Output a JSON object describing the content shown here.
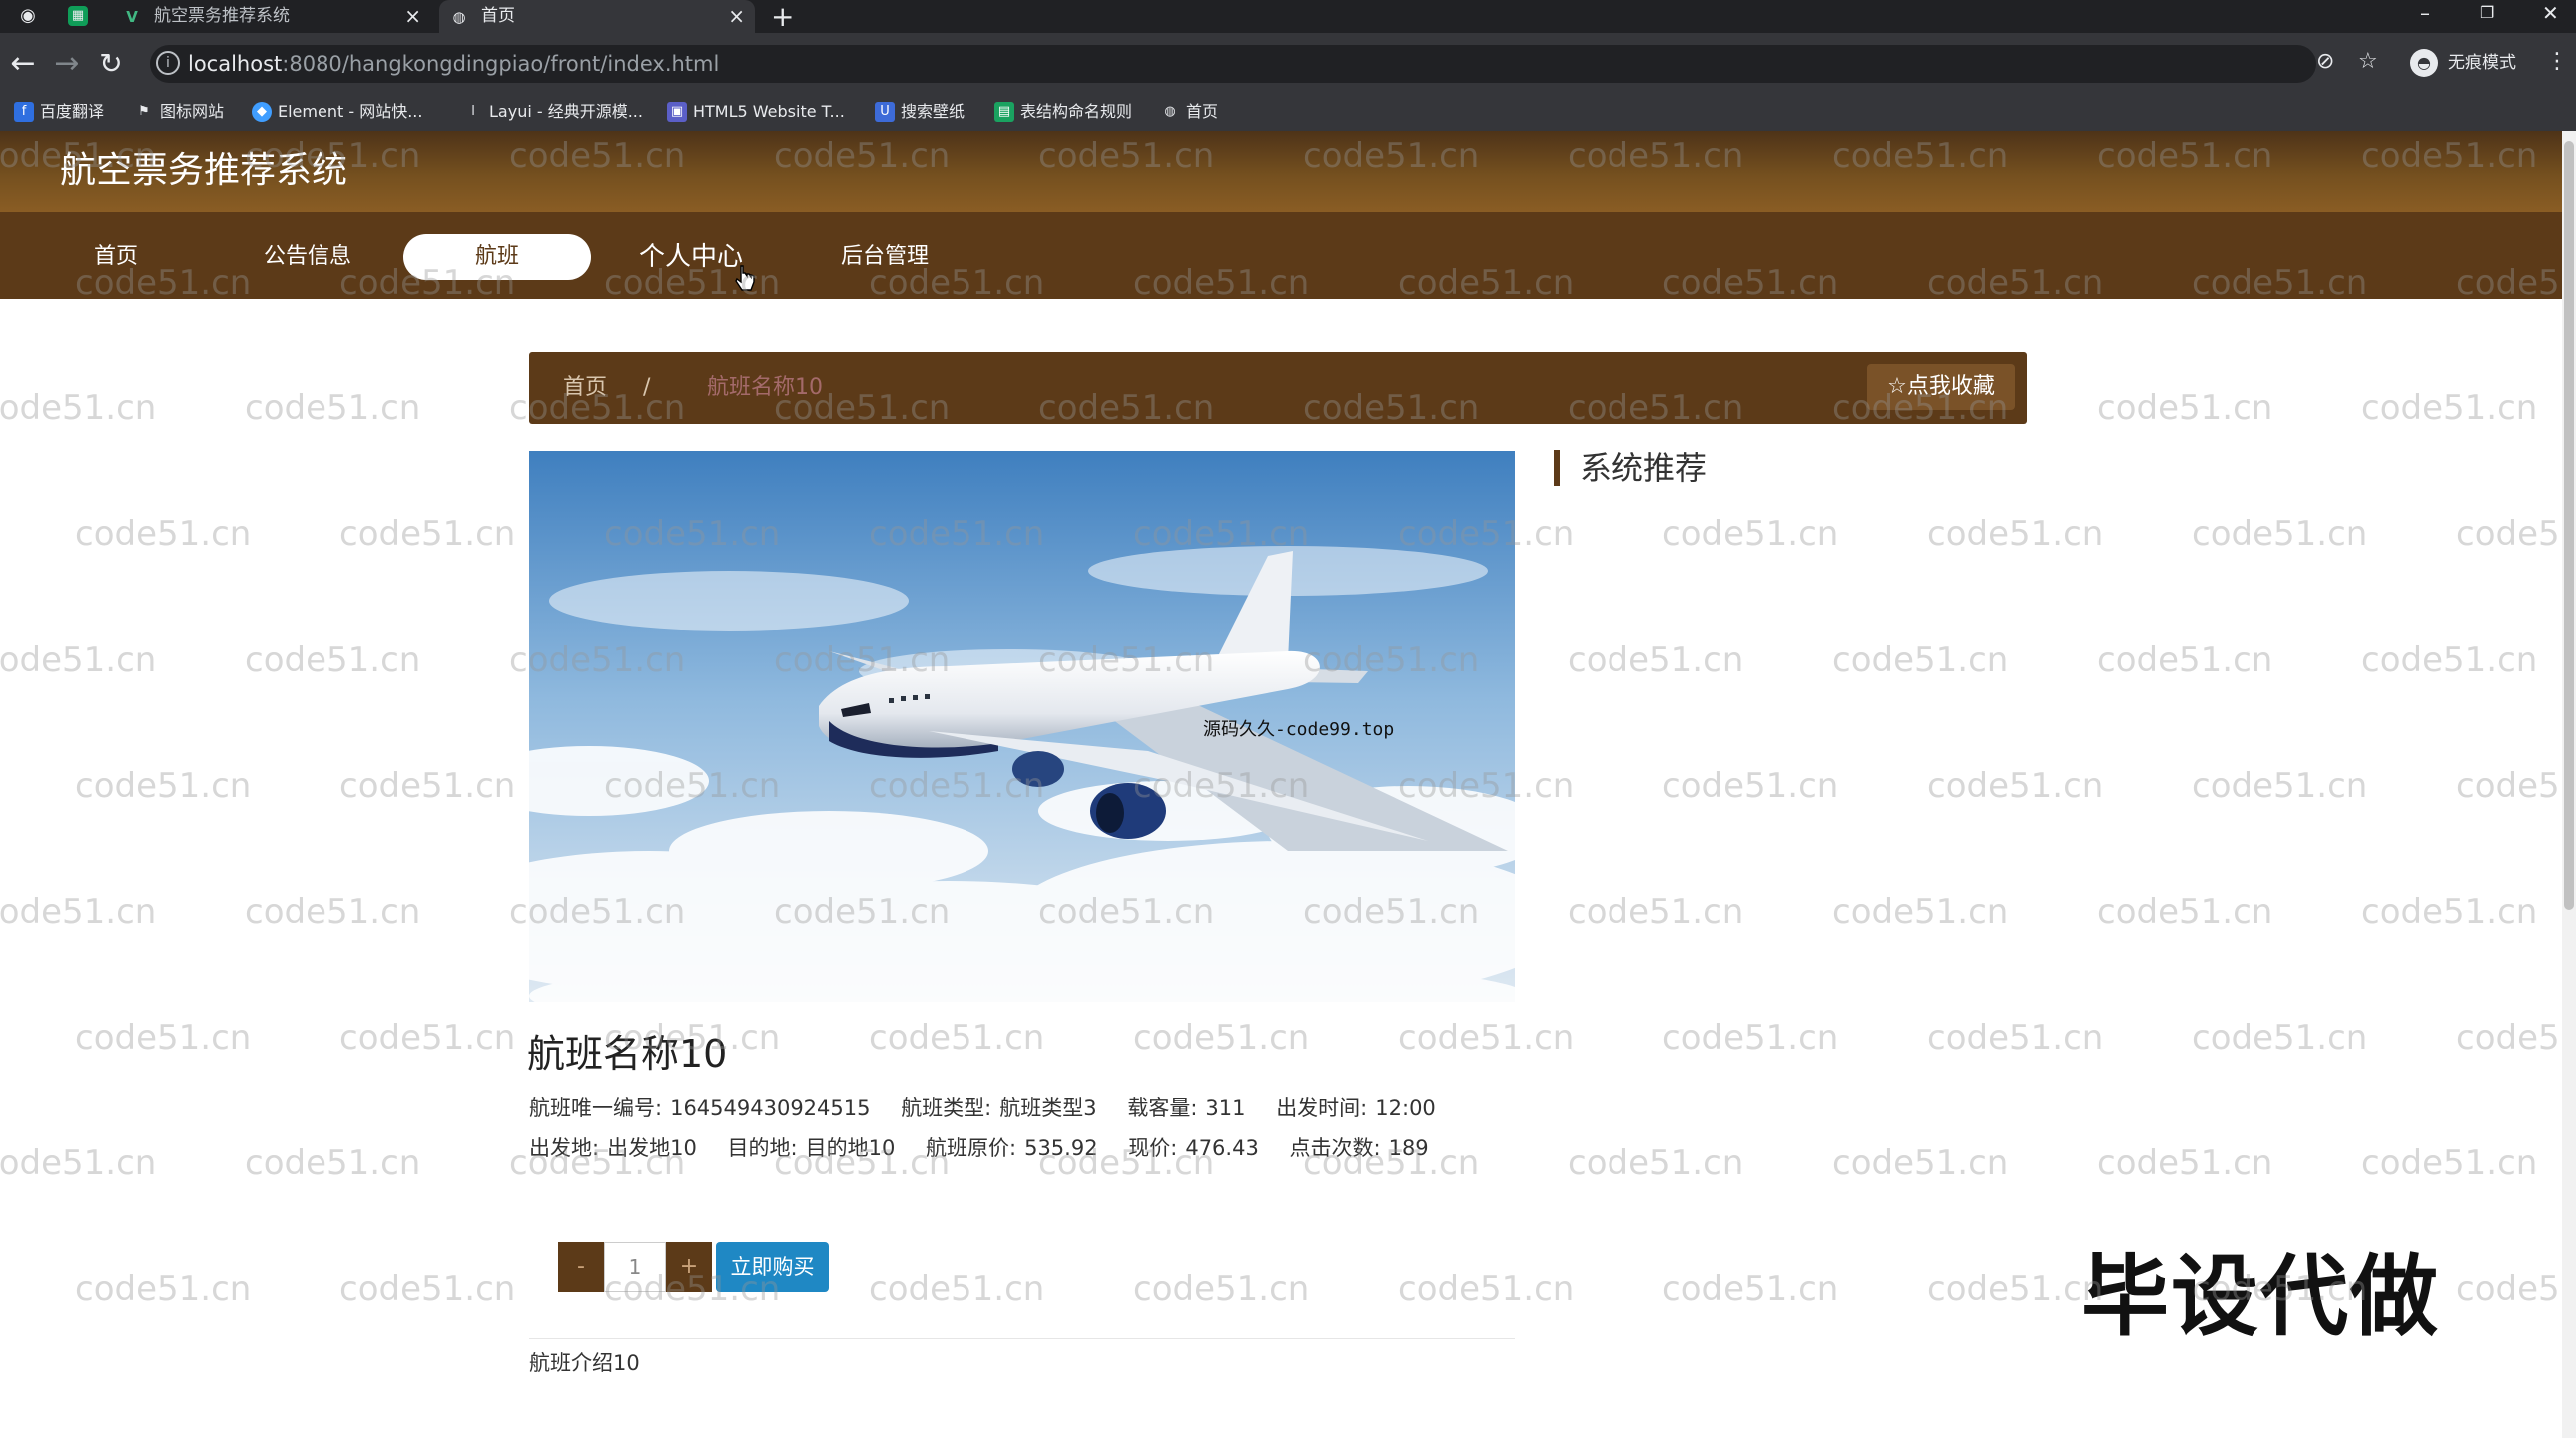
{
  "browser": {
    "tabs": [
      {
        "label": "航空票务推荐系统"
      },
      {
        "label": "首页"
      }
    ],
    "address": {
      "host": "localhost",
      "path": ":8080/hangkongdingpiao/front/index.html"
    },
    "profile_label": "无痕模式",
    "bookmarks": [
      {
        "label": "百度翻译",
        "icon": "translate-icon"
      },
      {
        "label": "图标网站",
        "icon": "flag-icon"
      },
      {
        "label": "Element - 网站快...",
        "icon": "element-icon"
      },
      {
        "label": "Layui - 经典开源模...",
        "icon": "layui-icon"
      },
      {
        "label": "HTML5 Website T...",
        "icon": "html5-icon"
      },
      {
        "label": "搜索壁纸",
        "icon": "wallpaper-icon"
      },
      {
        "label": "表结构命名规则",
        "icon": "table-icon"
      },
      {
        "label": "首页",
        "icon": "globe-icon"
      }
    ]
  },
  "site": {
    "title": "航空票务推荐系统",
    "nav": [
      {
        "label": "首页"
      },
      {
        "label": "公告信息"
      },
      {
        "label": "航班"
      },
      {
        "label": "个人中心"
      },
      {
        "label": "后台管理"
      }
    ],
    "active_nav": "航班",
    "accent_color": "#5c3a18",
    "buy_color": "#1f88c4"
  },
  "breadcrumb": {
    "home": "首页",
    "separator": "/",
    "current": "航班名称10",
    "favorite_label": "☆点我收藏"
  },
  "hero": {
    "image": "airplane-in-sky-photo",
    "overlay_text": "源码久久-code99.top"
  },
  "sidebar": {
    "title": "系统推荐"
  },
  "flight": {
    "name": "航班名称10",
    "line1": [
      {
        "label": "航班唯一编号:",
        "value": "164549430924515"
      },
      {
        "label": "航班类型:",
        "value": "航班类型3"
      },
      {
        "label": "载客量:",
        "value": "311"
      },
      {
        "label": "出发时间:",
        "value": "12:00"
      }
    ],
    "line2": [
      {
        "label": "出发地:",
        "value": "出发地10"
      },
      {
        "label": "目的地:",
        "value": "目的地10"
      },
      {
        "label": "航班原价:",
        "value": "535.92"
      },
      {
        "label": "现价:",
        "value": "476.43"
      },
      {
        "label": "点击次数:",
        "value": "189"
      }
    ],
    "quantity": "1",
    "minus_label": "-",
    "plus_label": "+",
    "buy_label": "立即购买",
    "intro": "航班介绍10"
  },
  "overlay": {
    "corner_text": "毕设代做",
    "watermark_text": "code51.cn"
  }
}
